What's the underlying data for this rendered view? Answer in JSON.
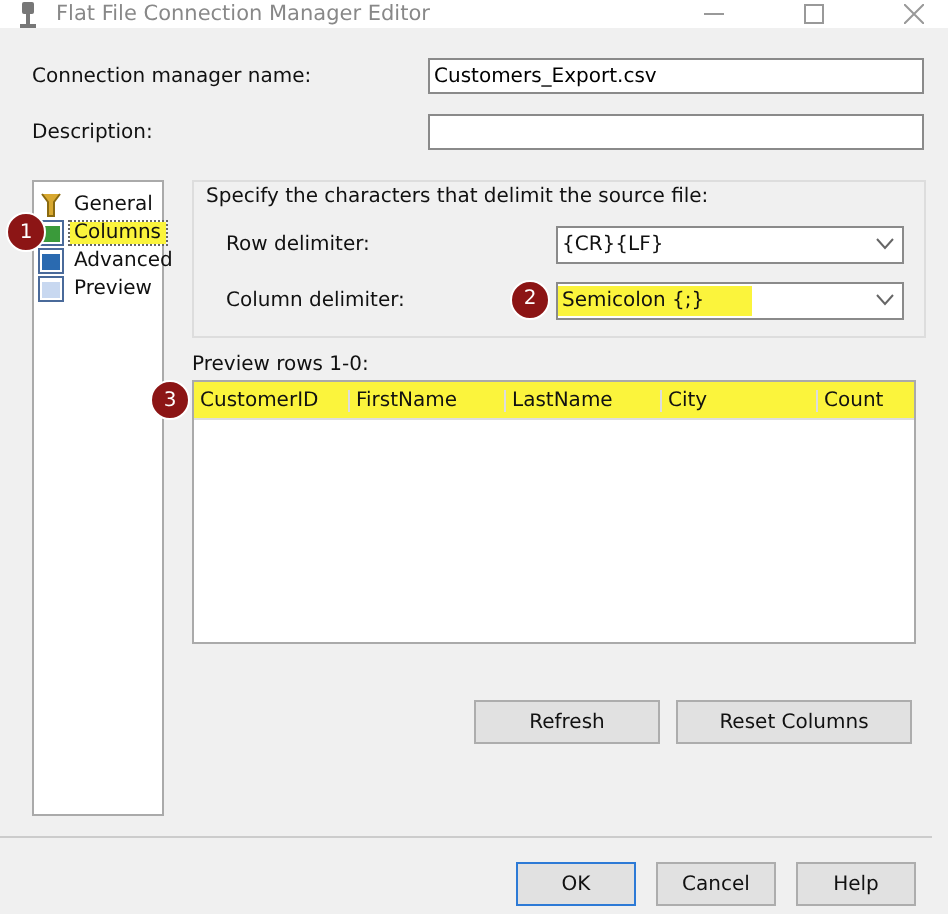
{
  "window": {
    "title": "Flat File Connection Manager Editor"
  },
  "fields": [
    {
      "label": "Connection manager name:",
      "value": "Customers_Export.csv"
    },
    {
      "label": "Description:"
    }
  ],
  "sidebar": {
    "items": [
      {
        "label": "General",
        "selected": false,
        "highlighted": false
      },
      {
        "label": "Columns",
        "selected": true,
        "highlighted": true,
        "badge": "1"
      },
      {
        "label": "Advanced",
        "selected": false,
        "highlighted": false
      },
      {
        "label": "Preview",
        "selected": false,
        "highlighted": false
      }
    ]
  },
  "delimiters": {
    "caption": "Specify the characters that delimit the source file:",
    "rows": [
      {
        "label": "Row delimiter:",
        "value": "{CR}{LF}",
        "highlighted": false
      },
      {
        "label": "Column delimiter:",
        "value": "Semicolon {;}",
        "highlighted": true,
        "badge": "2"
      }
    ]
  },
  "preview": {
    "label": "Preview rows 1-0:",
    "badge": "3",
    "highlighted": true,
    "columns": [
      "CustomerID",
      "FirstName",
      "LastName",
      "City",
      "Count"
    ]
  },
  "actions": [
    "Refresh",
    "Reset Columns"
  ],
  "buttons": [
    "OK",
    "Cancel",
    "Help"
  ]
}
